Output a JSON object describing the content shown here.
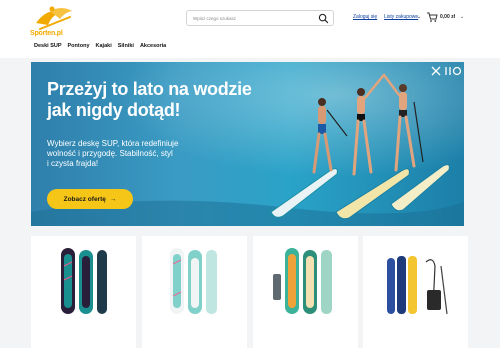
{
  "header": {
    "logo_text": "Sporten.pl",
    "search": {
      "placeholder": "Wpisz czego szukasz"
    },
    "login_label": "Zaloguj się",
    "lists_label": "Listy zakupowe",
    "cart_total": "0,00 zł"
  },
  "nav": {
    "items": [
      "Deski SUP",
      "Pontony",
      "Kajaki",
      "Silniki",
      "Akcesoria"
    ]
  },
  "hero": {
    "title_line1": "Przeżyj to lato na wodzie",
    "title_line2": "jak nigdy dotąd!",
    "subtitle_line1": "Wybierz deskę SUP, która redefiniuje",
    "subtitle_line2": "wolność i przygodę. Stabilność, styl",
    "subtitle_line3": "i czysta frajda!",
    "cta_label": "Zobacz ofertę",
    "cta_arrow": "→"
  },
  "colors": {
    "brand": "#f2a900",
    "link": "#0a3f9e",
    "cta": "#f5c518"
  },
  "products": [
    {
      "icon": "sup-board-set-icon",
      "accent": "#1a8f8f"
    },
    {
      "icon": "sup-board-set-icon",
      "accent": "#7fd1c9"
    },
    {
      "icon": "sup-board-set-icon",
      "accent": "#3bb39a"
    },
    {
      "icon": "sup-board-set-icon",
      "accent": "#2d4fa0"
    }
  ]
}
